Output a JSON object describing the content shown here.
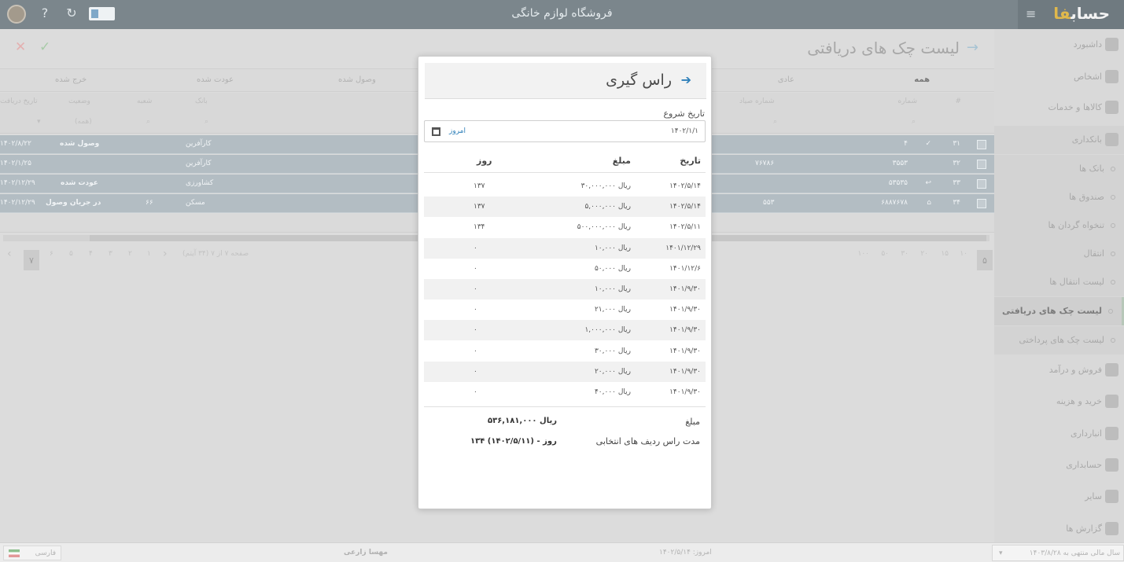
{
  "app": {
    "title": "فروشگاه لوازم خانگی",
    "brand_main": "حساب",
    "brand_accent": "فا",
    "menu_icon": "hamburger-icon",
    "refresh_icon": "refresh-icon",
    "help_icon": "help-icon",
    "flag_label": "فار"
  },
  "sidebar": {
    "items": [
      {
        "label": "داشبورد"
      },
      {
        "label": "اشخاص"
      },
      {
        "label": "کالاها و خدمات"
      },
      {
        "label": "بانکداری"
      },
      {
        "label": "بانک ها"
      },
      {
        "label": "صندوق ها"
      },
      {
        "label": "تنخواه گردان ها"
      },
      {
        "label": "انتقال"
      },
      {
        "label": "لیست انتقال ها"
      },
      {
        "label": "لیست چک های دریافتی"
      },
      {
        "label": "لیست چک های پرداختی"
      },
      {
        "label": "فروش و درآمد"
      },
      {
        "label": "خرید و هزینه"
      },
      {
        "label": "انبارداری"
      },
      {
        "label": "حسابداری"
      },
      {
        "label": "سایر"
      },
      {
        "label": "گزارش ها"
      }
    ]
  },
  "page": {
    "title": "لیست چک های دریافتی",
    "tabs": [
      "همه",
      "عادی",
      "وصول شده",
      "عودت شده",
      "خرج شده"
    ],
    "columns": {
      "number": "شماره",
      "serial": "شماره صیاد",
      "bank": "بانک",
      "branch": "شعبه",
      "status": "وضعیت",
      "receipt_date": "تاریخ دریافت",
      "index": "#"
    },
    "filter_all": "(همه)",
    "rows": [
      {
        "idx": "۳۱",
        "number": "۴",
        "serial": "",
        "bank": "کارآفرین",
        "branch": "",
        "status": "وصول شده",
        "date": "۱۴۰۲/۸/۲۲"
      },
      {
        "idx": "۳۲",
        "number": "۳۵۵۳",
        "serial": "۷۶۷۸۶",
        "bank": "کارآفرین",
        "branch": "",
        "status": "",
        "date": "۱۴۰۲/۱/۲۵"
      },
      {
        "idx": "۳۳",
        "number": "۵۳۵۳۵",
        "serial": "",
        "bank": "کشاورزی",
        "branch": "",
        "status": "عودت شده",
        "date": "۱۴۰۲/۱۲/۲۹"
      },
      {
        "idx": "۳۴",
        "number": "۶۸۸۷۶۷۸",
        "serial": "۵۵۳",
        "bank": "مسکن",
        "branch": "۶۶",
        "status": "در جریان وصول",
        "date": "۱۴۰۲/۱۲/۲۹"
      }
    ],
    "pager": {
      "info": "صفحه ۷ از ۷ (۳۴ آیتم)",
      "pages": [
        "۱",
        "۲",
        "۳",
        "۴",
        "۵",
        "۶",
        "۷"
      ],
      "sizes": [
        "۵",
        "۱۰",
        "۱۵",
        "۲۰",
        "۳۰",
        "۵۰",
        "۱۰۰"
      ]
    }
  },
  "modal": {
    "title": "راس گیری",
    "start_label": "تاریخ شروع",
    "start_value": "۱۴۰۲/۱/۱",
    "today_btn": "امروز",
    "headers": {
      "date": "تاریخ",
      "amount": "مبلغ",
      "days": "روز"
    },
    "rows": [
      {
        "date": "۱۴۰۲/۵/۱۴",
        "amount": "۳۰,۰۰۰,۰۰۰ ریال",
        "days": "۱۳۷"
      },
      {
        "date": "۱۴۰۲/۵/۱۴",
        "amount": "۵,۰۰۰,۰۰۰ ریال",
        "days": "۱۳۷"
      },
      {
        "date": "۱۴۰۲/۵/۱۱",
        "amount": "۵۰۰,۰۰۰,۰۰۰ ریال",
        "days": "۱۳۴"
      },
      {
        "date": "۱۴۰۱/۱۲/۲۹",
        "amount": "۱۰,۰۰۰ ریال",
        "days": "۰"
      },
      {
        "date": "۱۴۰۱/۱۲/۶",
        "amount": "۵۰,۰۰۰ ریال",
        "days": "۰"
      },
      {
        "date": "۱۴۰۱/۹/۳۰",
        "amount": "۱۰,۰۰۰ ریال",
        "days": "۰"
      },
      {
        "date": "۱۴۰۱/۹/۳۰",
        "amount": "۲۱,۰۰۰ ریال",
        "days": "۰"
      },
      {
        "date": "۱۴۰۱/۹/۳۰",
        "amount": "۱,۰۰۰,۰۰۰ ریال",
        "days": "۰"
      },
      {
        "date": "۱۴۰۱/۹/۳۰",
        "amount": "۳۰,۰۰۰ ریال",
        "days": "۰"
      },
      {
        "date": "۱۴۰۱/۹/۳۰",
        "amount": "۲۰,۰۰۰ ریال",
        "days": "۰"
      },
      {
        "date": "۱۴۰۱/۹/۳۰",
        "amount": "۴۰,۰۰۰ ریال",
        "days": "۰"
      }
    ],
    "summary": {
      "amount_label": "مبلغ",
      "amount_value": "۵۳۶,۱۸۱,۰۰۰ ریال",
      "duration_label": "مدت راس ردیف های انتخابی",
      "duration_value": "۱۳۴ روز - (۱۴۰۲/۵/۱۱)"
    }
  },
  "status": {
    "language": "فارسی",
    "user": "مهسا زارعی",
    "today": "امروز: ۱۴۰۲/۵/۱۴",
    "fiscal_year": "سال مالی منتهی به ۱۴۰۳/۸/۲۸"
  }
}
